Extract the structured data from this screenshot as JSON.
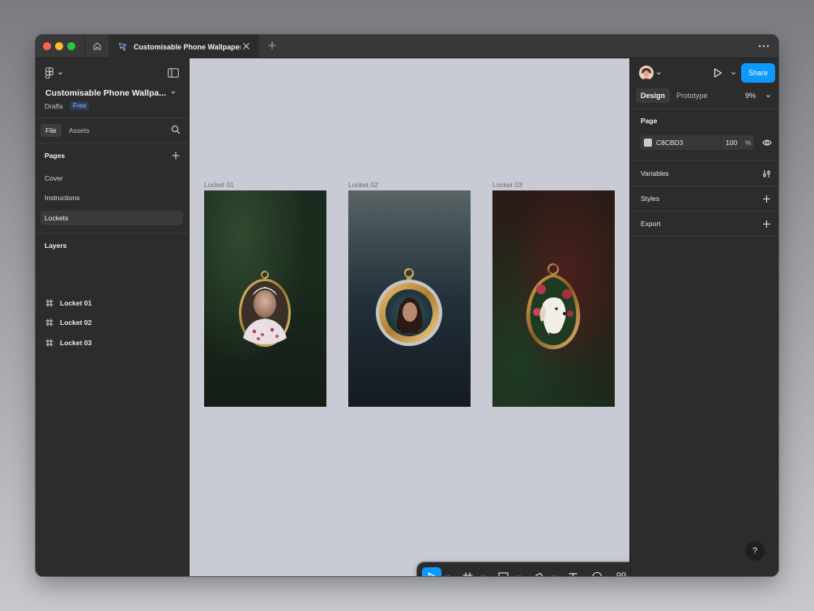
{
  "window": {
    "tab_title": "Customisable Phone Wallpaper -"
  },
  "left_panel": {
    "file_name": "Customisable Phone Wallpa...",
    "location": "Drafts",
    "plan_badge": "Free",
    "tabs": [
      {
        "label": "File"
      },
      {
        "label": "Assets"
      }
    ],
    "pages_title": "Pages",
    "pages": [
      {
        "label": "Cover",
        "active": false
      },
      {
        "label": "Instructions",
        "active": false
      },
      {
        "label": "Lockets",
        "active": true
      }
    ],
    "layers_title": "Layers",
    "layers": [
      {
        "label": "Locket 01",
        "icon": "frame-icon"
      },
      {
        "label": "Locket 02",
        "icon": "frame-icon"
      },
      {
        "label": "Locket 03",
        "icon": "frame-icon"
      }
    ]
  },
  "canvas": {
    "background": "#C8CBD3",
    "frames": [
      {
        "label": "Locket 01",
        "subject": "elderly woman portrait in oval gold locket"
      },
      {
        "label": "Locket 02",
        "subject": "young woman portrait in round gold locket"
      },
      {
        "label": "Locket 03",
        "subject": "white dog with roses in oval gold locket"
      }
    ]
  },
  "toolbar": {
    "tools": [
      "move-icon",
      "frame-icon",
      "rectangle-icon",
      "pen-icon",
      "text-icon",
      "comment-icon",
      "components-icon"
    ],
    "modes": [
      "draw-mode-icon",
      "design-mode-icon",
      "dev-mode-icon"
    ],
    "active_tool": "move-icon",
    "active_mode": "design-mode-icon"
  },
  "right_panel": {
    "share_label": "Share",
    "tabs": [
      {
        "label": "Design"
      },
      {
        "label": "Prototype"
      }
    ],
    "zoom": "9%",
    "page_section": {
      "title": "Page",
      "fill_hex": "C8CBD3",
      "opacity": "100",
      "opacity_unit": "%"
    },
    "sections": [
      {
        "label": "Variables",
        "icon": "variables-settings-icon"
      },
      {
        "label": "Styles",
        "icon": "plus-icon"
      },
      {
        "label": "Export",
        "icon": "plus-icon"
      }
    ],
    "help_label": "?"
  },
  "colors": {
    "accent": "#0D99FF",
    "panel_bg": "#2C2C2C",
    "canvas_bg": "#C8CBD3"
  }
}
